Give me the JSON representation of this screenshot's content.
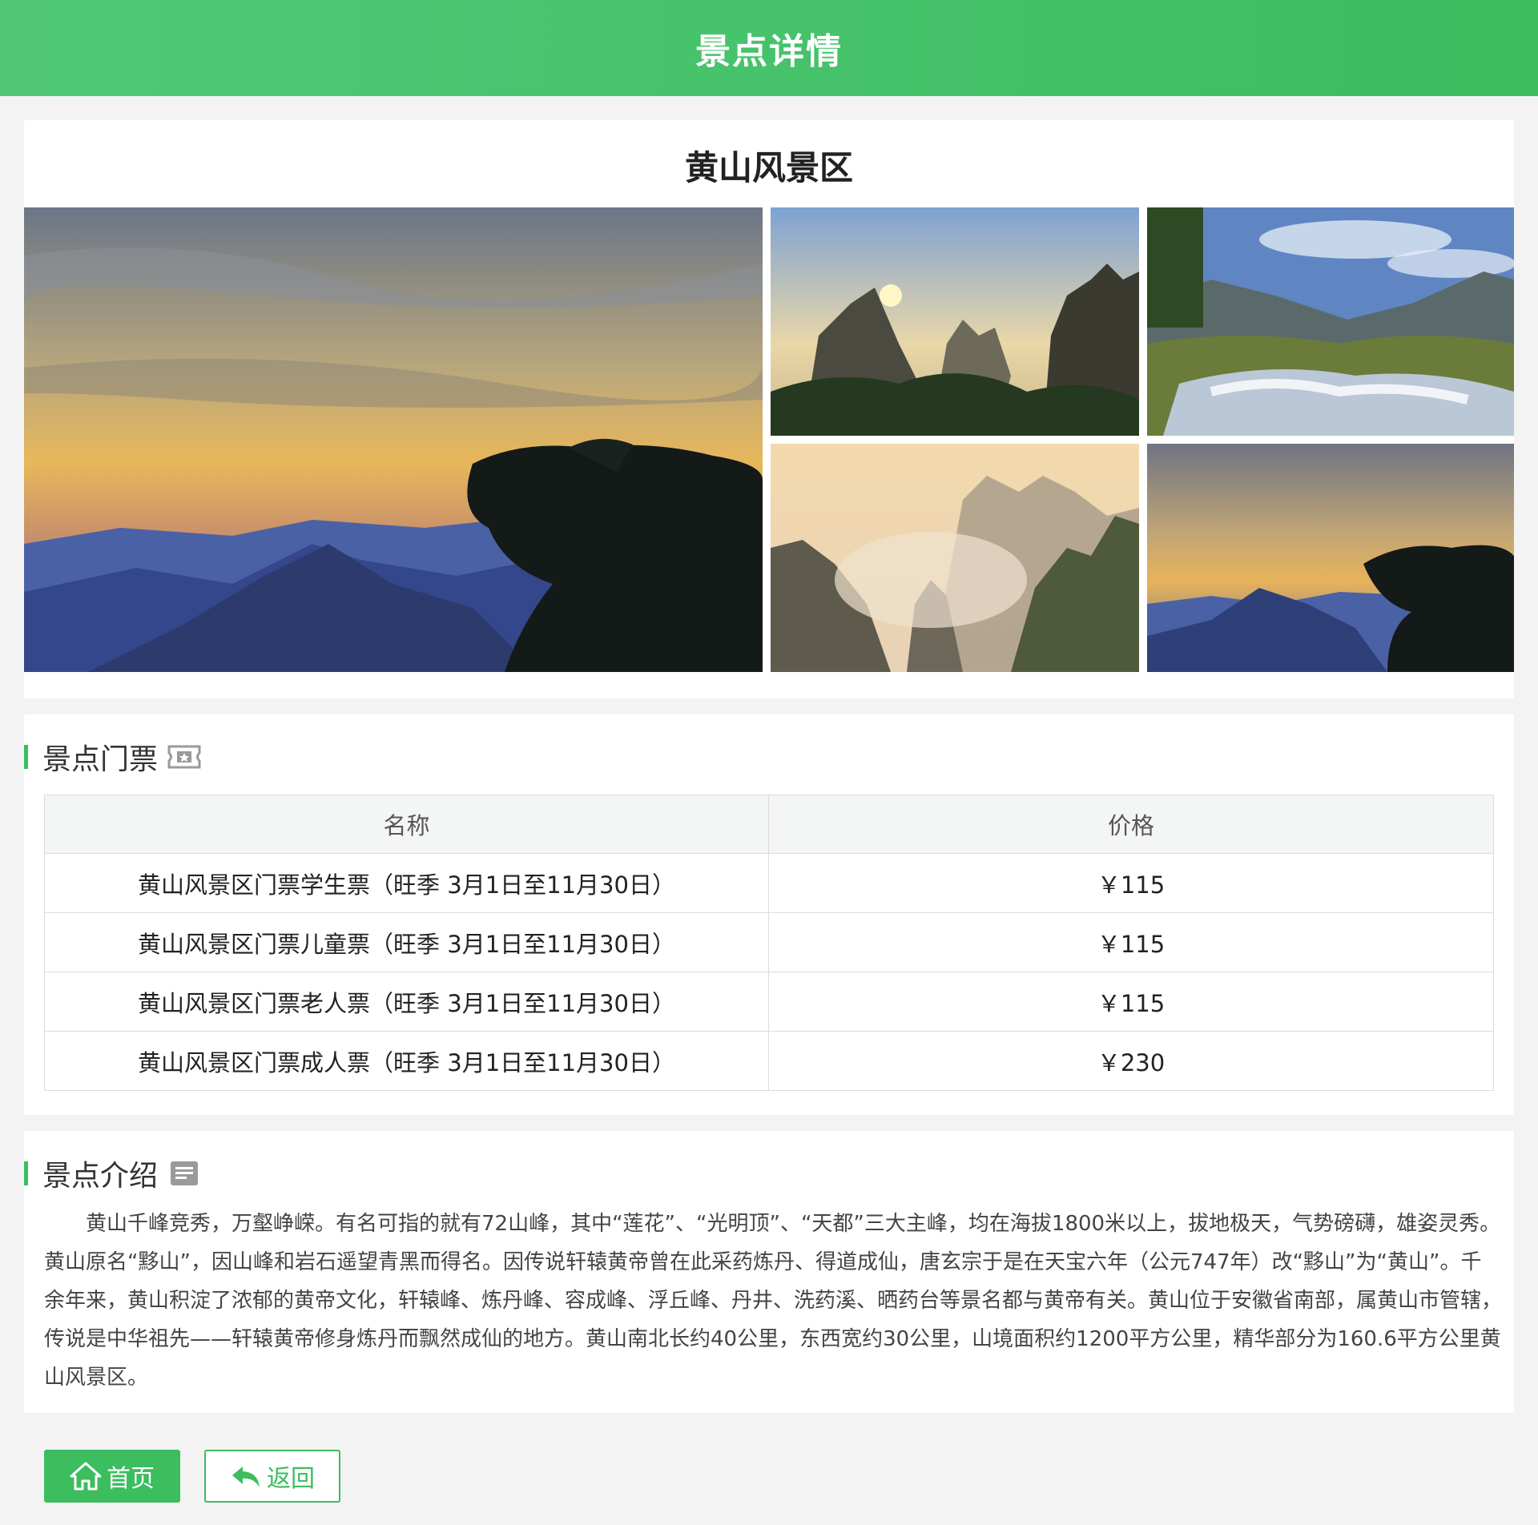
{
  "header": {
    "title": "景点详情"
  },
  "scenic": {
    "name": "黄山风景区"
  },
  "gallery": {
    "photos": [
      "sunset-pine-mountains-photo",
      "sunrise-peaks-photo",
      "waterfall-stream-photo",
      "sea-of-clouds-photo",
      "sunset-pine-mountains-photo-small"
    ]
  },
  "tickets": {
    "title": "景点门票",
    "icon": "ticket-icon",
    "headers": {
      "name": "名称",
      "price": "价格"
    },
    "rows": [
      {
        "name": "黄山风景区门票学生票（旺季  3月1日至11月30日）",
        "price": "￥115"
      },
      {
        "name": "黄山风景区门票儿童票（旺季  3月1日至11月30日）",
        "price": "￥115"
      },
      {
        "name": "黄山风景区门票老人票（旺季  3月1日至11月30日）",
        "price": "￥115"
      },
      {
        "name": "黄山风景区门票成人票（旺季  3月1日至11月30日）",
        "price": "￥230"
      }
    ]
  },
  "intro": {
    "title": "景点介绍",
    "icon": "document-icon",
    "text": "黄山千峰竞秀，万壑峥嵘。有名可指的就有72山峰，其中“莲花”、“光明顶”、“天都”三大主峰，均在海拔1800米以上，拔地极天，气势磅礴，雄姿灵秀。黄山原名“黟山”，因山峰和岩石遥望青黑而得名。因传说轩辕黄帝曾在此采药炼丹、得道成仙，唐玄宗于是在天宝六年（公元747年）改“黟山”为“黄山”。千余年来，黄山积淀了浓郁的黄帝文化，轩辕峰、炼丹峰、容成峰、浮丘峰、丹井、洗药溪、晒药台等景名都与黄帝有关。黄山位于安徽省南部，属黄山市管辖，传说是中华祖先——轩辕黄帝修身炼丹而飘然成仙的地方。黄山南北长约40公里，东西宽约30公里，山境面积约1200平方公里，精华部分为160.6平方公里黄山风景区。"
  },
  "actions": {
    "home_label": "首页",
    "back_label": "返回"
  },
  "colors": {
    "accent": "#3cbd5e",
    "header_start": "#50c878"
  }
}
